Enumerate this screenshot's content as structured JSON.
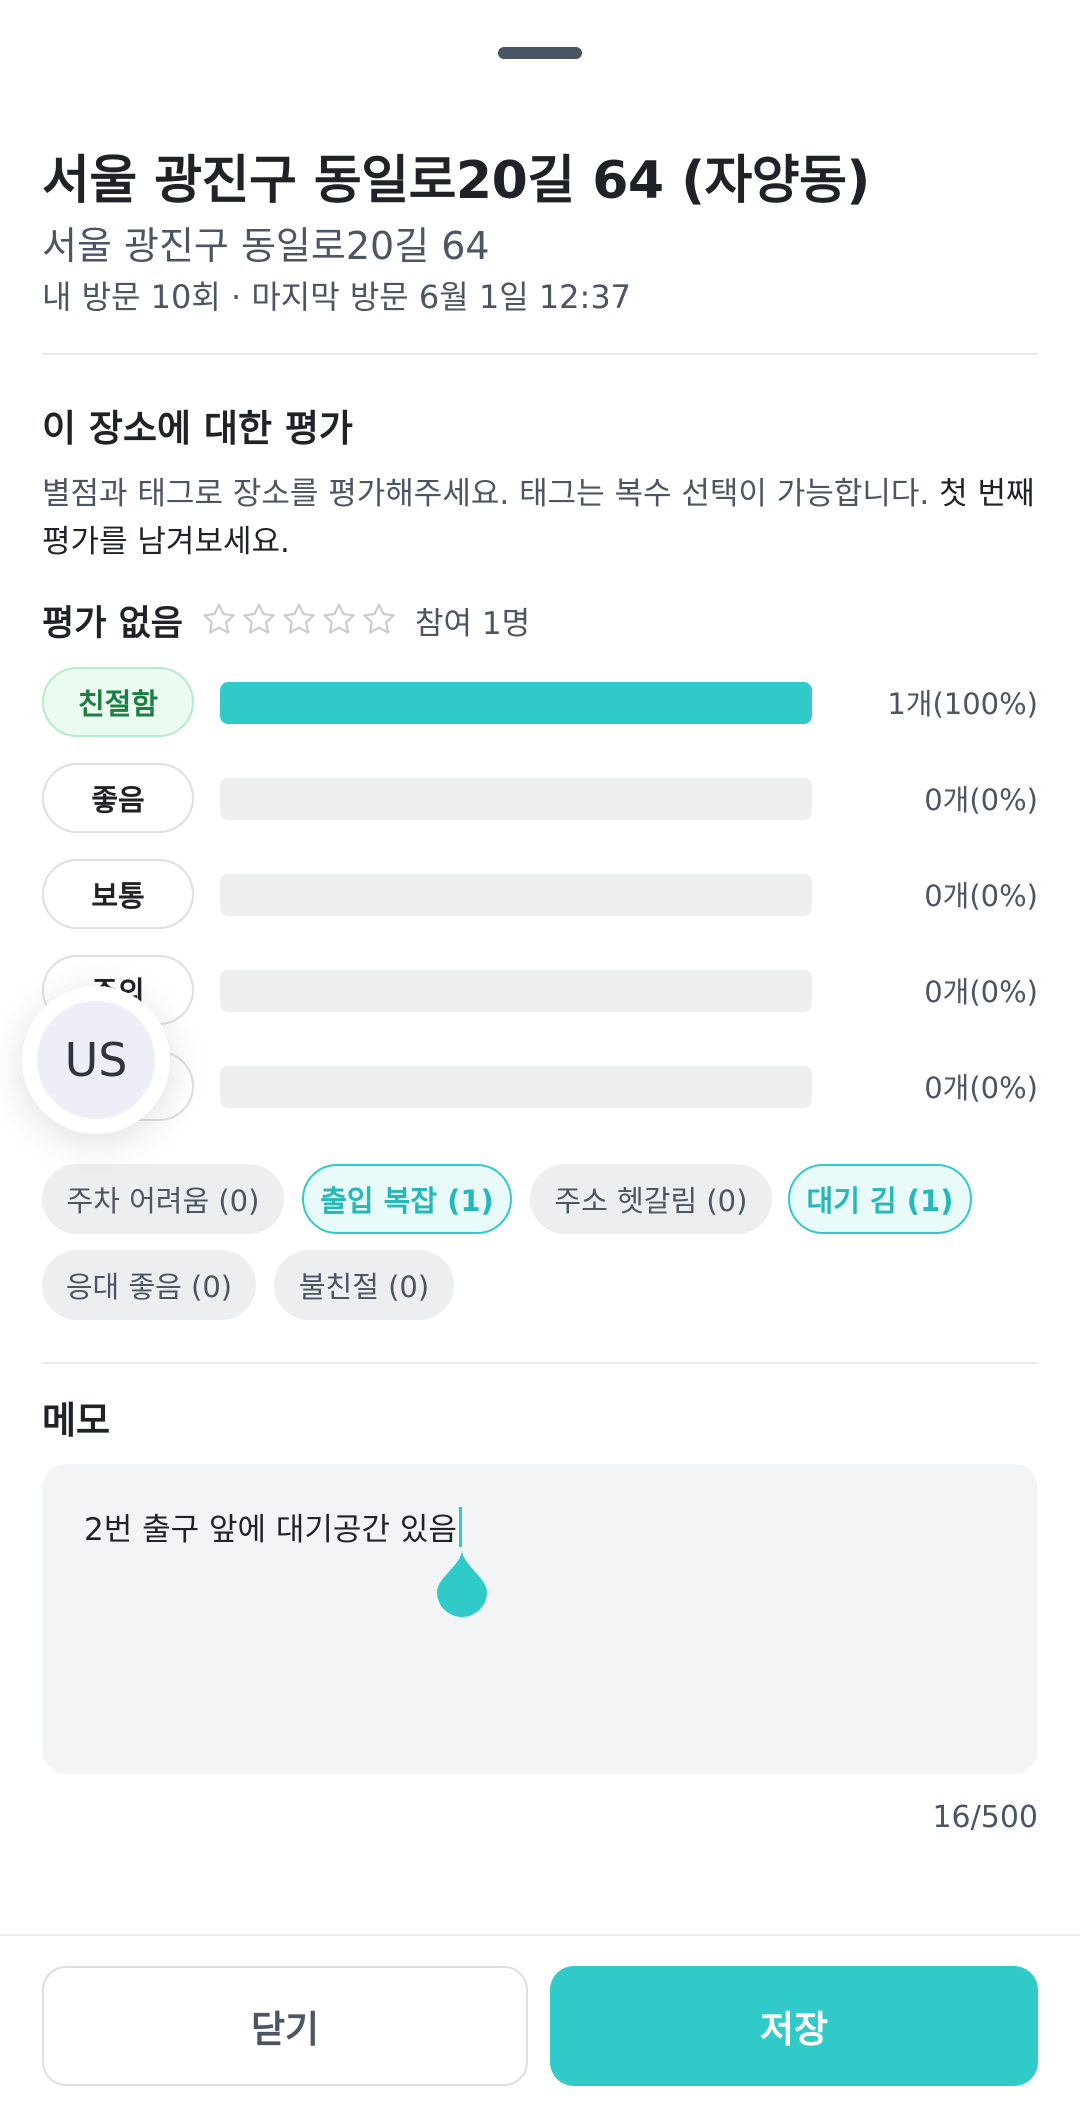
{
  "place": {
    "title": "서울 광진구 동일로20길 64 (자양동)",
    "address": "서울 광진구 동일로20길 64",
    "visit_info": "내 방문 10회 · 마지막 방문 6월 1일 12:37"
  },
  "rating_section": {
    "title": "이 장소에 대한 평가",
    "description": "별점과 태그로 장소를 평가해주세요. 태그는 복수 선택이 가능합니다. ",
    "description_cta": "첫 번째 평가를 남겨보세요.",
    "rating_label": "평가 없음",
    "stars_filled": 0,
    "stars_total": 5,
    "participants": "참여 1명"
  },
  "score_rows": [
    {
      "label": "친절함",
      "count": "1개(100%)",
      "fraction": 1.0,
      "active": true
    },
    {
      "label": "좋음",
      "count": "0개(0%)",
      "fraction": 0,
      "active": false
    },
    {
      "label": "보통",
      "count": "0개(0%)",
      "fraction": 0,
      "active": false
    },
    {
      "label": "주의",
      "count": "0개(0%)",
      "fraction": 0,
      "active": false
    },
    {
      "label": "",
      "count": "0개(0%)",
      "fraction": 0,
      "active": false
    }
  ],
  "tags": [
    {
      "label": "주차 어려움 (0)",
      "active": false
    },
    {
      "label": "출입 복잡 (1)",
      "active": true
    },
    {
      "label": "주소 헷갈림 (0)",
      "active": false
    },
    {
      "label": "대기 김 (1)",
      "active": true
    },
    {
      "label": "응대 좋음 (0)",
      "active": false
    },
    {
      "label": "불친절 (0)",
      "active": false
    }
  ],
  "memo": {
    "title": "메모",
    "value": "2번 출구 앞에 대기공간 있음",
    "char_count": "16/500"
  },
  "buttons": {
    "close": "닫기",
    "save": "저장"
  },
  "avatar": {
    "initials": "US"
  },
  "colors": {
    "accent": "#30cbc9",
    "active_pill_bg": "#ebfbf1",
    "active_pill_text": "#1b7f43"
  }
}
